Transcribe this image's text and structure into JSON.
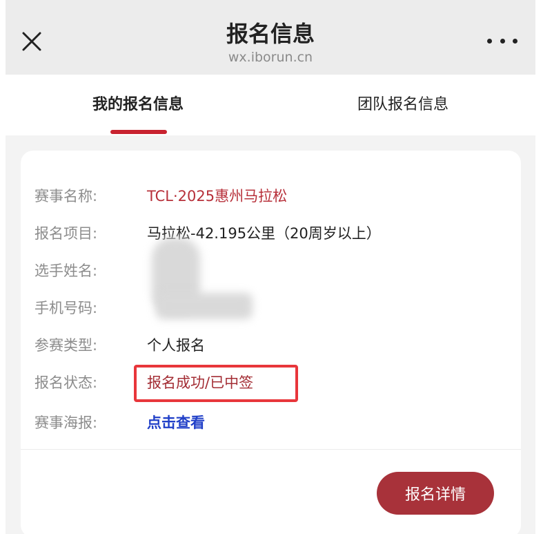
{
  "header": {
    "title": "报名信息",
    "subtitle": "wx.iborun.cn"
  },
  "tabs": [
    {
      "label": "我的报名信息",
      "active": true
    },
    {
      "label": "团队报名信息",
      "active": false
    }
  ],
  "card": {
    "fields": [
      {
        "label": "赛事名称:",
        "value": "TCL·2025惠州马拉松"
      },
      {
        "label": "报名项目:",
        "value": "马拉松-42.195公里（20周岁以上）"
      },
      {
        "label": "选手姓名:",
        "value": ""
      },
      {
        "label": "手机号码:",
        "value": ""
      },
      {
        "label": "参赛类型:",
        "value": "个人报名"
      },
      {
        "label": "报名状态:",
        "value": "报名成功/已中签"
      },
      {
        "label": "赛事海报:",
        "value": "点击查看"
      }
    ],
    "detail_button": "报名详情"
  },
  "colors": {
    "accent_red": "#c8222f",
    "value_red": "#b7303a",
    "link_blue": "#2140c8",
    "button_bg": "#a8323a",
    "highlight_border": "#e8363b"
  },
  "icons": {
    "close": "close-icon",
    "more": "more-dots-icon"
  }
}
